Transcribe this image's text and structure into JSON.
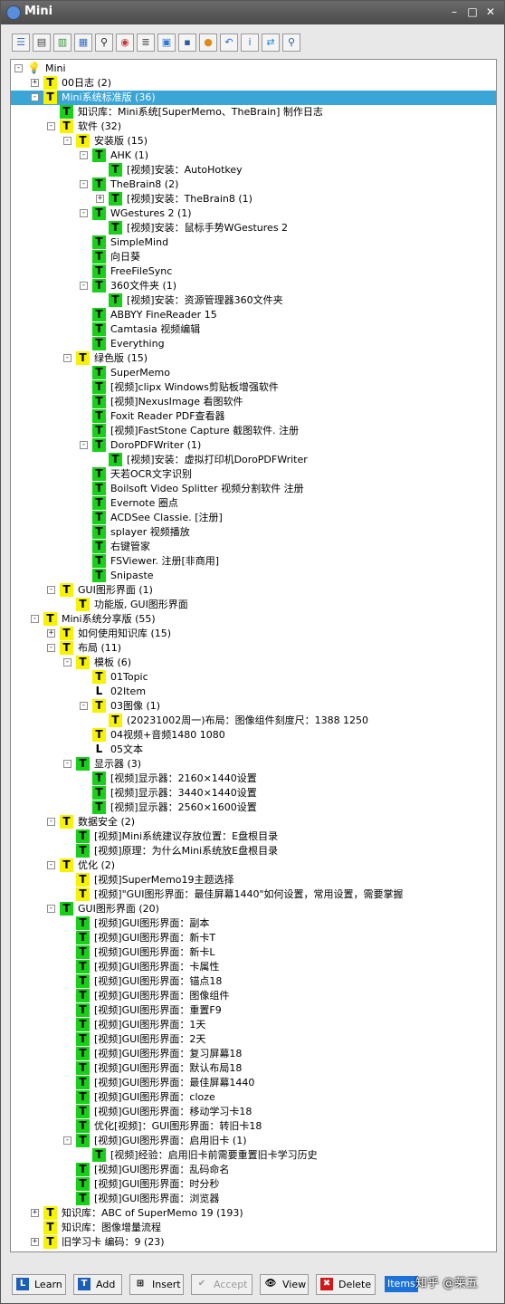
{
  "window": {
    "title": "Mini",
    "controls": [
      "–",
      "□",
      "✕"
    ]
  },
  "toolbar": {
    "buttons": [
      {
        "name": "contents-button",
        "glyph": "☰"
      },
      {
        "name": "browser-button",
        "glyph": "▤"
      },
      {
        "name": "elements-button",
        "glyph": "▥"
      },
      {
        "name": "register-button",
        "glyph": "▦"
      },
      {
        "name": "search-button",
        "glyph": "⚲"
      },
      {
        "name": "view-button",
        "glyph": "◉"
      },
      {
        "name": "outline-button",
        "glyph": "≣"
      },
      {
        "name": "image-button",
        "glyph": "▣"
      },
      {
        "name": "save-button",
        "glyph": "▪"
      },
      {
        "name": "add-button",
        "glyph": "●"
      },
      {
        "name": "undo-button",
        "glyph": "↶"
      },
      {
        "name": "info-button",
        "glyph": "i"
      },
      {
        "name": "swap-button",
        "glyph": "⇄"
      },
      {
        "name": "find-button",
        "glyph": "⚲"
      }
    ]
  },
  "tree": {
    "rows": [
      {
        "d": 0,
        "exp": "-",
        "icon": "bulb",
        "glyph": "💡",
        "text": "Mini"
      },
      {
        "d": 1,
        "exp": "+",
        "icon": "yellow",
        "glyph": "T",
        "text": "00日志 (2)"
      },
      {
        "d": 1,
        "exp": "-",
        "icon": "yellow",
        "glyph": "T",
        "text": "Mini系统标准版 (36)",
        "sel": true
      },
      {
        "d": 2,
        "exp": "",
        "icon": "green",
        "glyph": "T",
        "text": "知识库：Mini系统[SuperMemo、TheBrain] 制作日志"
      },
      {
        "d": 2,
        "exp": "-",
        "icon": "yellow",
        "glyph": "T",
        "text": "软件 (32)"
      },
      {
        "d": 3,
        "exp": "-",
        "icon": "yellow",
        "glyph": "T",
        "text": "安装版 (15)"
      },
      {
        "d": 4,
        "exp": "-",
        "icon": "green",
        "glyph": "T",
        "text": "AHK (1)"
      },
      {
        "d": 5,
        "exp": "",
        "icon": "green",
        "glyph": "T",
        "text": "[视频]安装：AutoHotkey"
      },
      {
        "d": 4,
        "exp": "-",
        "icon": "green",
        "glyph": "T",
        "text": "TheBrain8 (2)"
      },
      {
        "d": 5,
        "exp": "+",
        "icon": "green",
        "glyph": "T",
        "text": "[视频]安装：TheBrain8 (1)"
      },
      {
        "d": 4,
        "exp": "-",
        "icon": "green",
        "glyph": "T",
        "text": "WGestures 2 (1)"
      },
      {
        "d": 5,
        "exp": "",
        "icon": "green",
        "glyph": "T",
        "text": "[视频]安装：鼠标手势WGestures 2"
      },
      {
        "d": 4,
        "exp": "",
        "icon": "green",
        "glyph": "T",
        "text": "SimpleMind"
      },
      {
        "d": 4,
        "exp": "",
        "icon": "green",
        "glyph": "T",
        "text": "向日葵"
      },
      {
        "d": 4,
        "exp": "",
        "icon": "green",
        "glyph": "T",
        "text": "FreeFileSync"
      },
      {
        "d": 4,
        "exp": "-",
        "icon": "green",
        "glyph": "T",
        "text": "360文件夹 (1)"
      },
      {
        "d": 5,
        "exp": "",
        "icon": "green",
        "glyph": "T",
        "text": "[视频]安装：资源管理器360文件夹"
      },
      {
        "d": 4,
        "exp": "",
        "icon": "green",
        "glyph": "T",
        "text": "ABBYY FineReader 15"
      },
      {
        "d": 4,
        "exp": "",
        "icon": "green",
        "glyph": "T",
        "text": "Camtasia 视频编辑"
      },
      {
        "d": 4,
        "exp": "",
        "icon": "green",
        "glyph": "T",
        "text": "Everything"
      },
      {
        "d": 3,
        "exp": "-",
        "icon": "yellow",
        "glyph": "T",
        "text": "绿色版 (15)"
      },
      {
        "d": 4,
        "exp": "",
        "icon": "green",
        "glyph": "T",
        "text": "SuperMemo"
      },
      {
        "d": 4,
        "exp": "",
        "icon": "green",
        "glyph": "T",
        "text": "[视频]clipx Windows剪贴板增强软件"
      },
      {
        "d": 4,
        "exp": "",
        "icon": "green",
        "glyph": "T",
        "text": "[视频]NexusImage 看图软件"
      },
      {
        "d": 4,
        "exp": "",
        "icon": "green",
        "glyph": "T",
        "text": "Foxit Reader PDF查看器"
      },
      {
        "d": 4,
        "exp": "",
        "icon": "green",
        "glyph": "T",
        "text": "[视频]FastStone Capture 截图软件. 注册"
      },
      {
        "d": 4,
        "exp": "-",
        "icon": "green",
        "glyph": "T",
        "text": "DoroPDFWriter (1)"
      },
      {
        "d": 5,
        "exp": "",
        "icon": "green",
        "glyph": "T",
        "text": "[视频]安装：虚拟打印机DoroPDFWriter"
      },
      {
        "d": 4,
        "exp": "",
        "icon": "green",
        "glyph": "T",
        "text": "天若OCR文字识别"
      },
      {
        "d": 4,
        "exp": "",
        "icon": "green",
        "glyph": "T",
        "text": "Boilsoft Video Splitter 视频分割软件 注册"
      },
      {
        "d": 4,
        "exp": "",
        "icon": "green",
        "glyph": "T",
        "text": "Evernote 圈点"
      },
      {
        "d": 4,
        "exp": "",
        "icon": "green",
        "glyph": "T",
        "text": "ACDSee Classie. [注册]"
      },
      {
        "d": 4,
        "exp": "",
        "icon": "green",
        "glyph": "T",
        "text": "splayer 视频播放"
      },
      {
        "d": 4,
        "exp": "",
        "icon": "green",
        "glyph": "T",
        "text": "右键管家"
      },
      {
        "d": 4,
        "exp": "",
        "icon": "green",
        "glyph": "T",
        "text": "FSViewer. 注册[非商用]"
      },
      {
        "d": 4,
        "exp": "",
        "icon": "green",
        "glyph": "T",
        "text": "Snipaste"
      },
      {
        "d": 2,
        "exp": "-",
        "icon": "yellow",
        "glyph": "T",
        "text": "GUI图形界面 (1)"
      },
      {
        "d": 3,
        "exp": "",
        "icon": "yellow",
        "glyph": "T",
        "text": "功能版, GUI图形界面"
      },
      {
        "d": 1,
        "exp": "-",
        "icon": "yellow",
        "glyph": "T",
        "text": "Mini系统分享版 (55)"
      },
      {
        "d": 2,
        "exp": "+",
        "icon": "yellow",
        "glyph": "T",
        "text": "如何使用知识库 (15)"
      },
      {
        "d": 2,
        "exp": "-",
        "icon": "yellow",
        "glyph": "T",
        "text": "布局 (11)"
      },
      {
        "d": 3,
        "exp": "-",
        "icon": "yellow",
        "glyph": "T",
        "text": "模板 (6)"
      },
      {
        "d": 4,
        "exp": "",
        "icon": "yellow",
        "glyph": "T",
        "text": "01Topic"
      },
      {
        "d": 4,
        "exp": "",
        "icon": "white",
        "glyph": "L",
        "text": "02Item"
      },
      {
        "d": 4,
        "exp": "-",
        "icon": "yellow",
        "glyph": "T",
        "text": "03图像 (1)"
      },
      {
        "d": 5,
        "exp": "",
        "icon": "yellow",
        "glyph": "T",
        "text": "(20231002周一)布局：图像组件刻度尺：1388 1250"
      },
      {
        "d": 4,
        "exp": "",
        "icon": "yellow",
        "glyph": "T",
        "text": "04视频+音频1480 1080"
      },
      {
        "d": 4,
        "exp": "",
        "icon": "white",
        "glyph": "L",
        "text": "05文本"
      },
      {
        "d": 3,
        "exp": "-",
        "icon": "green",
        "glyph": "T",
        "text": "显示器 (3)"
      },
      {
        "d": 4,
        "exp": "",
        "icon": "green",
        "glyph": "T",
        "text": "[视频]显示器：2160×1440设置"
      },
      {
        "d": 4,
        "exp": "",
        "icon": "green",
        "glyph": "T",
        "text": "[视频]显示器：3440×1440设置"
      },
      {
        "d": 4,
        "exp": "",
        "icon": "green",
        "glyph": "T",
        "text": "[视频]显示器：2560×1600设置"
      },
      {
        "d": 2,
        "exp": "-",
        "icon": "yellow",
        "glyph": "T",
        "text": "数据安全 (2)"
      },
      {
        "d": 3,
        "exp": "",
        "icon": "green",
        "glyph": "T",
        "text": "[视频]Mini系统建议存放位置：E盘根目录"
      },
      {
        "d": 3,
        "exp": "",
        "icon": "green",
        "glyph": "T",
        "text": "[视频]原理：为什么Mini系统放E盘根目录"
      },
      {
        "d": 2,
        "exp": "-",
        "icon": "yellow",
        "glyph": "T",
        "text": "优化 (2)"
      },
      {
        "d": 3,
        "exp": "",
        "icon": "yellow",
        "glyph": "T",
        "text": "[视频]SuperMemo19主题选择"
      },
      {
        "d": 3,
        "exp": "",
        "icon": "yellow",
        "glyph": "T",
        "text": "[视频]\"GUI图形界面：最佳屏幕1440\"如何设置，常用设置，需要掌握"
      },
      {
        "d": 2,
        "exp": "-",
        "icon": "green",
        "glyph": "T",
        "text": "GUI图形界面 (20)"
      },
      {
        "d": 3,
        "exp": "",
        "icon": "green",
        "glyph": "T",
        "text": "[视频]GUI图形界面：副本"
      },
      {
        "d": 3,
        "exp": "",
        "icon": "green",
        "glyph": "T",
        "text": "[视频]GUI图形界面：新卡T"
      },
      {
        "d": 3,
        "exp": "",
        "icon": "green",
        "glyph": "T",
        "text": "[视频]GUI图形界面：新卡L"
      },
      {
        "d": 3,
        "exp": "",
        "icon": "green",
        "glyph": "T",
        "text": "[视频]GUI图形界面：卡属性"
      },
      {
        "d": 3,
        "exp": "",
        "icon": "green",
        "glyph": "T",
        "text": "[视频]GUI图形界面：锚点18"
      },
      {
        "d": 3,
        "exp": "",
        "icon": "green",
        "glyph": "T",
        "text": "[视频]GUI图形界面：图像组件"
      },
      {
        "d": 3,
        "exp": "",
        "icon": "green",
        "glyph": "T",
        "text": "[视频]GUI图形界面：重置F9"
      },
      {
        "d": 3,
        "exp": "",
        "icon": "green",
        "glyph": "T",
        "text": "[视频]GUI图形界面：1天"
      },
      {
        "d": 3,
        "exp": "",
        "icon": "green",
        "glyph": "T",
        "text": "[视频]GUI图形界面：2天"
      },
      {
        "d": 3,
        "exp": "",
        "icon": "green",
        "glyph": "T",
        "text": "[视频]GUI图形界面：复习屏幕18"
      },
      {
        "d": 3,
        "exp": "",
        "icon": "green",
        "glyph": "T",
        "text": "[视频]GUI图形界面：默认布局18"
      },
      {
        "d": 3,
        "exp": "",
        "icon": "green",
        "glyph": "T",
        "text": "[视频]GUI图形界面：最佳屏幕1440"
      },
      {
        "d": 3,
        "exp": "",
        "icon": "green",
        "glyph": "T",
        "text": "[视频]GUI图形界面：cloze"
      },
      {
        "d": 3,
        "exp": "",
        "icon": "green",
        "glyph": "T",
        "text": "[视频]GUI图形界面：移动学习卡18"
      },
      {
        "d": 3,
        "exp": "",
        "icon": "green",
        "glyph": "T",
        "text": "优化[视频]：GUI图形界面：转旧卡18"
      },
      {
        "d": 3,
        "exp": "-",
        "icon": "green",
        "glyph": "T",
        "text": "[视频]GUI图形界面：启用旧卡 (1)"
      },
      {
        "d": 4,
        "exp": "",
        "icon": "green",
        "glyph": "T",
        "text": "[视频]经验：启用旧卡前需要重置旧卡学习历史"
      },
      {
        "d": 3,
        "exp": "",
        "icon": "green",
        "glyph": "T",
        "text": "[视频]GUI图形界面：乱码命名"
      },
      {
        "d": 3,
        "exp": "",
        "icon": "green",
        "glyph": "T",
        "text": "[视频]GUI图形界面：时分秒"
      },
      {
        "d": 3,
        "exp": "",
        "icon": "green",
        "glyph": "T",
        "text": "[视频]GUI图形界面：浏览器"
      },
      {
        "d": 1,
        "exp": "+",
        "icon": "yellow",
        "glyph": "T",
        "text": "知识库：ABC of SuperMemo 19 (193)"
      },
      {
        "d": 1,
        "exp": "",
        "icon": "yellow",
        "glyph": "T",
        "text": "知识库：图像增量流程"
      },
      {
        "d": 1,
        "exp": "+",
        "icon": "yellow",
        "glyph": "T",
        "text": "旧学习卡 编码：9 (23)"
      }
    ]
  },
  "bottom": {
    "learn": "Learn",
    "add": "Add",
    "insert": "Insert",
    "accept": "Accept",
    "view": "View",
    "delete": "Delete",
    "items": "Items",
    "watermark": "知乎 @莱五"
  },
  "icons": {
    "learn": "L",
    "add": "T",
    "insert": "⊞",
    "accept": "✔",
    "view": "👁",
    "delete": "✖"
  },
  "colors": {
    "selection": "#3aa6d8",
    "topic_yellow": "#f6f200",
    "item_green": "#18d018",
    "titlebar": "#4a4a4a"
  }
}
